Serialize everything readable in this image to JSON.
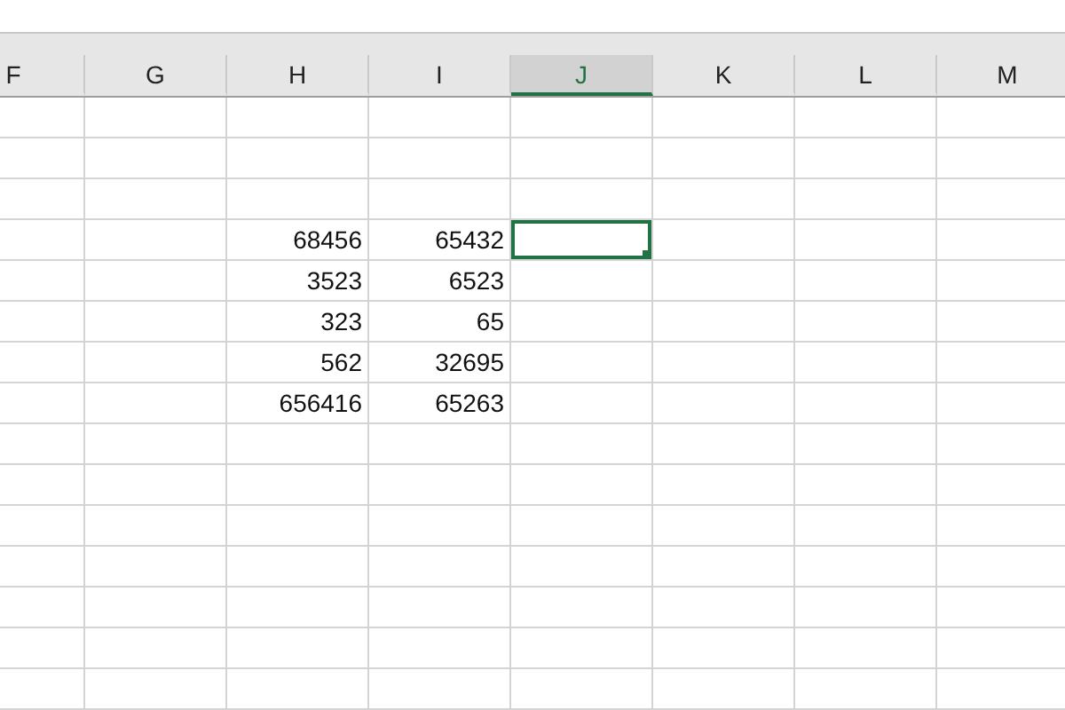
{
  "columns": [
    {
      "label": "F",
      "selected": false
    },
    {
      "label": "G",
      "selected": false
    },
    {
      "label": "H",
      "selected": false
    },
    {
      "label": "I",
      "selected": false
    },
    {
      "label": "J",
      "selected": true
    },
    {
      "label": "K",
      "selected": false
    },
    {
      "label": "L",
      "selected": false
    },
    {
      "label": "M",
      "selected": false
    }
  ],
  "rows": [
    {
      "cells": [
        {
          "selected": false
        },
        {
          "selected": false
        },
        {
          "selected": false
        },
        {
          "selected": false
        },
        {
          "selected": false
        },
        {
          "selected": false
        },
        {
          "selected": false
        },
        {
          "selected": false
        }
      ]
    },
    {
      "cells": [
        {
          "selected": false
        },
        {
          "selected": false
        },
        {
          "selected": false
        },
        {
          "selected": false
        },
        {
          "selected": false
        },
        {
          "selected": false
        },
        {
          "selected": false
        },
        {
          "selected": false
        }
      ]
    },
    {
      "cells": [
        {
          "selected": false
        },
        {
          "selected": false
        },
        {
          "selected": false
        },
        {
          "selected": false
        },
        {
          "selected": false
        },
        {
          "selected": false
        },
        {
          "selected": false
        },
        {
          "selected": false
        }
      ]
    },
    {
      "cells": [
        {
          "selected": false
        },
        {
          "selected": false
        },
        {
          "selected": false,
          "text": "68456"
        },
        {
          "selected": false,
          "text": "65432"
        },
        {
          "selected": true
        },
        {
          "selected": false
        },
        {
          "selected": false
        },
        {
          "selected": false
        }
      ]
    },
    {
      "cells": [
        {
          "selected": false
        },
        {
          "selected": false
        },
        {
          "selected": false,
          "text": "3523"
        },
        {
          "selected": false,
          "text": "6523"
        },
        {
          "selected": false
        },
        {
          "selected": false
        },
        {
          "selected": false
        },
        {
          "selected": false
        }
      ]
    },
    {
      "cells": [
        {
          "selected": false
        },
        {
          "selected": false
        },
        {
          "selected": false,
          "text": "323"
        },
        {
          "selected": false,
          "text": "65"
        },
        {
          "selected": false
        },
        {
          "selected": false
        },
        {
          "selected": false
        },
        {
          "selected": false
        }
      ]
    },
    {
      "cells": [
        {
          "selected": false
        },
        {
          "selected": false
        },
        {
          "selected": false,
          "text": "562"
        },
        {
          "selected": false,
          "text": "32695"
        },
        {
          "selected": false
        },
        {
          "selected": false
        },
        {
          "selected": false
        },
        {
          "selected": false
        }
      ]
    },
    {
      "cells": [
        {
          "selected": false
        },
        {
          "selected": false
        },
        {
          "selected": false,
          "text": "656416"
        },
        {
          "selected": false,
          "text": "65263"
        },
        {
          "selected": false
        },
        {
          "selected": false
        },
        {
          "selected": false
        },
        {
          "selected": false
        }
      ]
    },
    {
      "cells": [
        {
          "selected": false
        },
        {
          "selected": false
        },
        {
          "selected": false
        },
        {
          "selected": false
        },
        {
          "selected": false
        },
        {
          "selected": false
        },
        {
          "selected": false
        },
        {
          "selected": false
        }
      ]
    },
    {
      "cells": [
        {
          "selected": false
        },
        {
          "selected": false
        },
        {
          "selected": false
        },
        {
          "selected": false
        },
        {
          "selected": false
        },
        {
          "selected": false
        },
        {
          "selected": false
        },
        {
          "selected": false
        }
      ]
    },
    {
      "cells": [
        {
          "selected": false
        },
        {
          "selected": false
        },
        {
          "selected": false
        },
        {
          "selected": false
        },
        {
          "selected": false
        },
        {
          "selected": false
        },
        {
          "selected": false
        },
        {
          "selected": false
        }
      ]
    },
    {
      "cells": [
        {
          "selected": false
        },
        {
          "selected": false
        },
        {
          "selected": false
        },
        {
          "selected": false
        },
        {
          "selected": false
        },
        {
          "selected": false
        },
        {
          "selected": false
        },
        {
          "selected": false
        }
      ]
    },
    {
      "cells": [
        {
          "selected": false
        },
        {
          "selected": false
        },
        {
          "selected": false
        },
        {
          "selected": false
        },
        {
          "selected": false
        },
        {
          "selected": false
        },
        {
          "selected": false
        },
        {
          "selected": false
        }
      ]
    },
    {
      "cells": [
        {
          "selected": false
        },
        {
          "selected": false
        },
        {
          "selected": false
        },
        {
          "selected": false
        },
        {
          "selected": false
        },
        {
          "selected": false
        },
        {
          "selected": false
        },
        {
          "selected": false
        }
      ]
    },
    {
      "cells": [
        {
          "selected": false
        },
        {
          "selected": false
        },
        {
          "selected": false
        },
        {
          "selected": false
        },
        {
          "selected": false
        },
        {
          "selected": false
        },
        {
          "selected": false
        },
        {
          "selected": false
        }
      ]
    }
  ]
}
